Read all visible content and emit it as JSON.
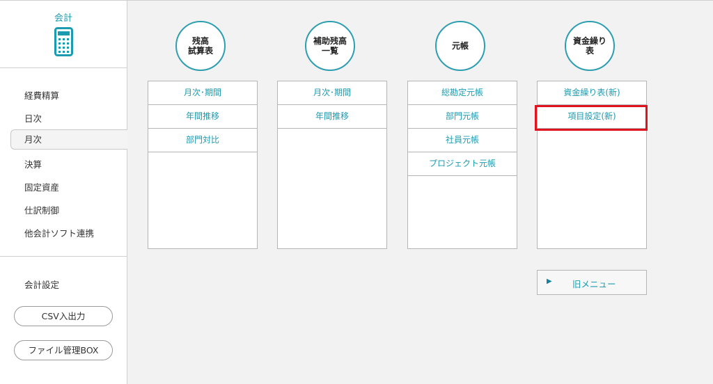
{
  "sidebar": {
    "app_title": "会計",
    "items": [
      {
        "label": "経費精算"
      },
      {
        "label": "日次"
      },
      {
        "label": "月次"
      },
      {
        "label": "決算"
      },
      {
        "label": "固定資産"
      },
      {
        "label": "仕訳制御"
      },
      {
        "label": "他会計ソフト連携"
      }
    ],
    "active_item": "月次",
    "settings_label": "会計設定",
    "csv_button": "CSV入出力",
    "filebox_button": "ファイル管理BOX"
  },
  "columns": [
    {
      "circle_line1": "残高",
      "circle_line2": "試算表",
      "items": [
        "月次･期間",
        "年間推移",
        "部門対比"
      ]
    },
    {
      "circle_line1": "補助残高",
      "circle_line2": "一覧",
      "items": [
        "月次･期間",
        "年間推移"
      ]
    },
    {
      "circle_line1": "元帳",
      "circle_line2": "",
      "items": [
        "総勘定元帳",
        "部門元帳",
        "社員元帳",
        "プロジェクト元帳"
      ]
    },
    {
      "circle_line1": "資金繰り",
      "circle_line2": "表",
      "items": [
        "資金繰り表(新)",
        "項目設定(新)"
      ]
    }
  ],
  "old_menu": {
    "icon": "play-triangle-icon",
    "label": "旧メニュー"
  },
  "colors": {
    "accent": "#1a9bb0",
    "circle_border": "#2c9eaf",
    "highlight": "#e0141e"
  }
}
